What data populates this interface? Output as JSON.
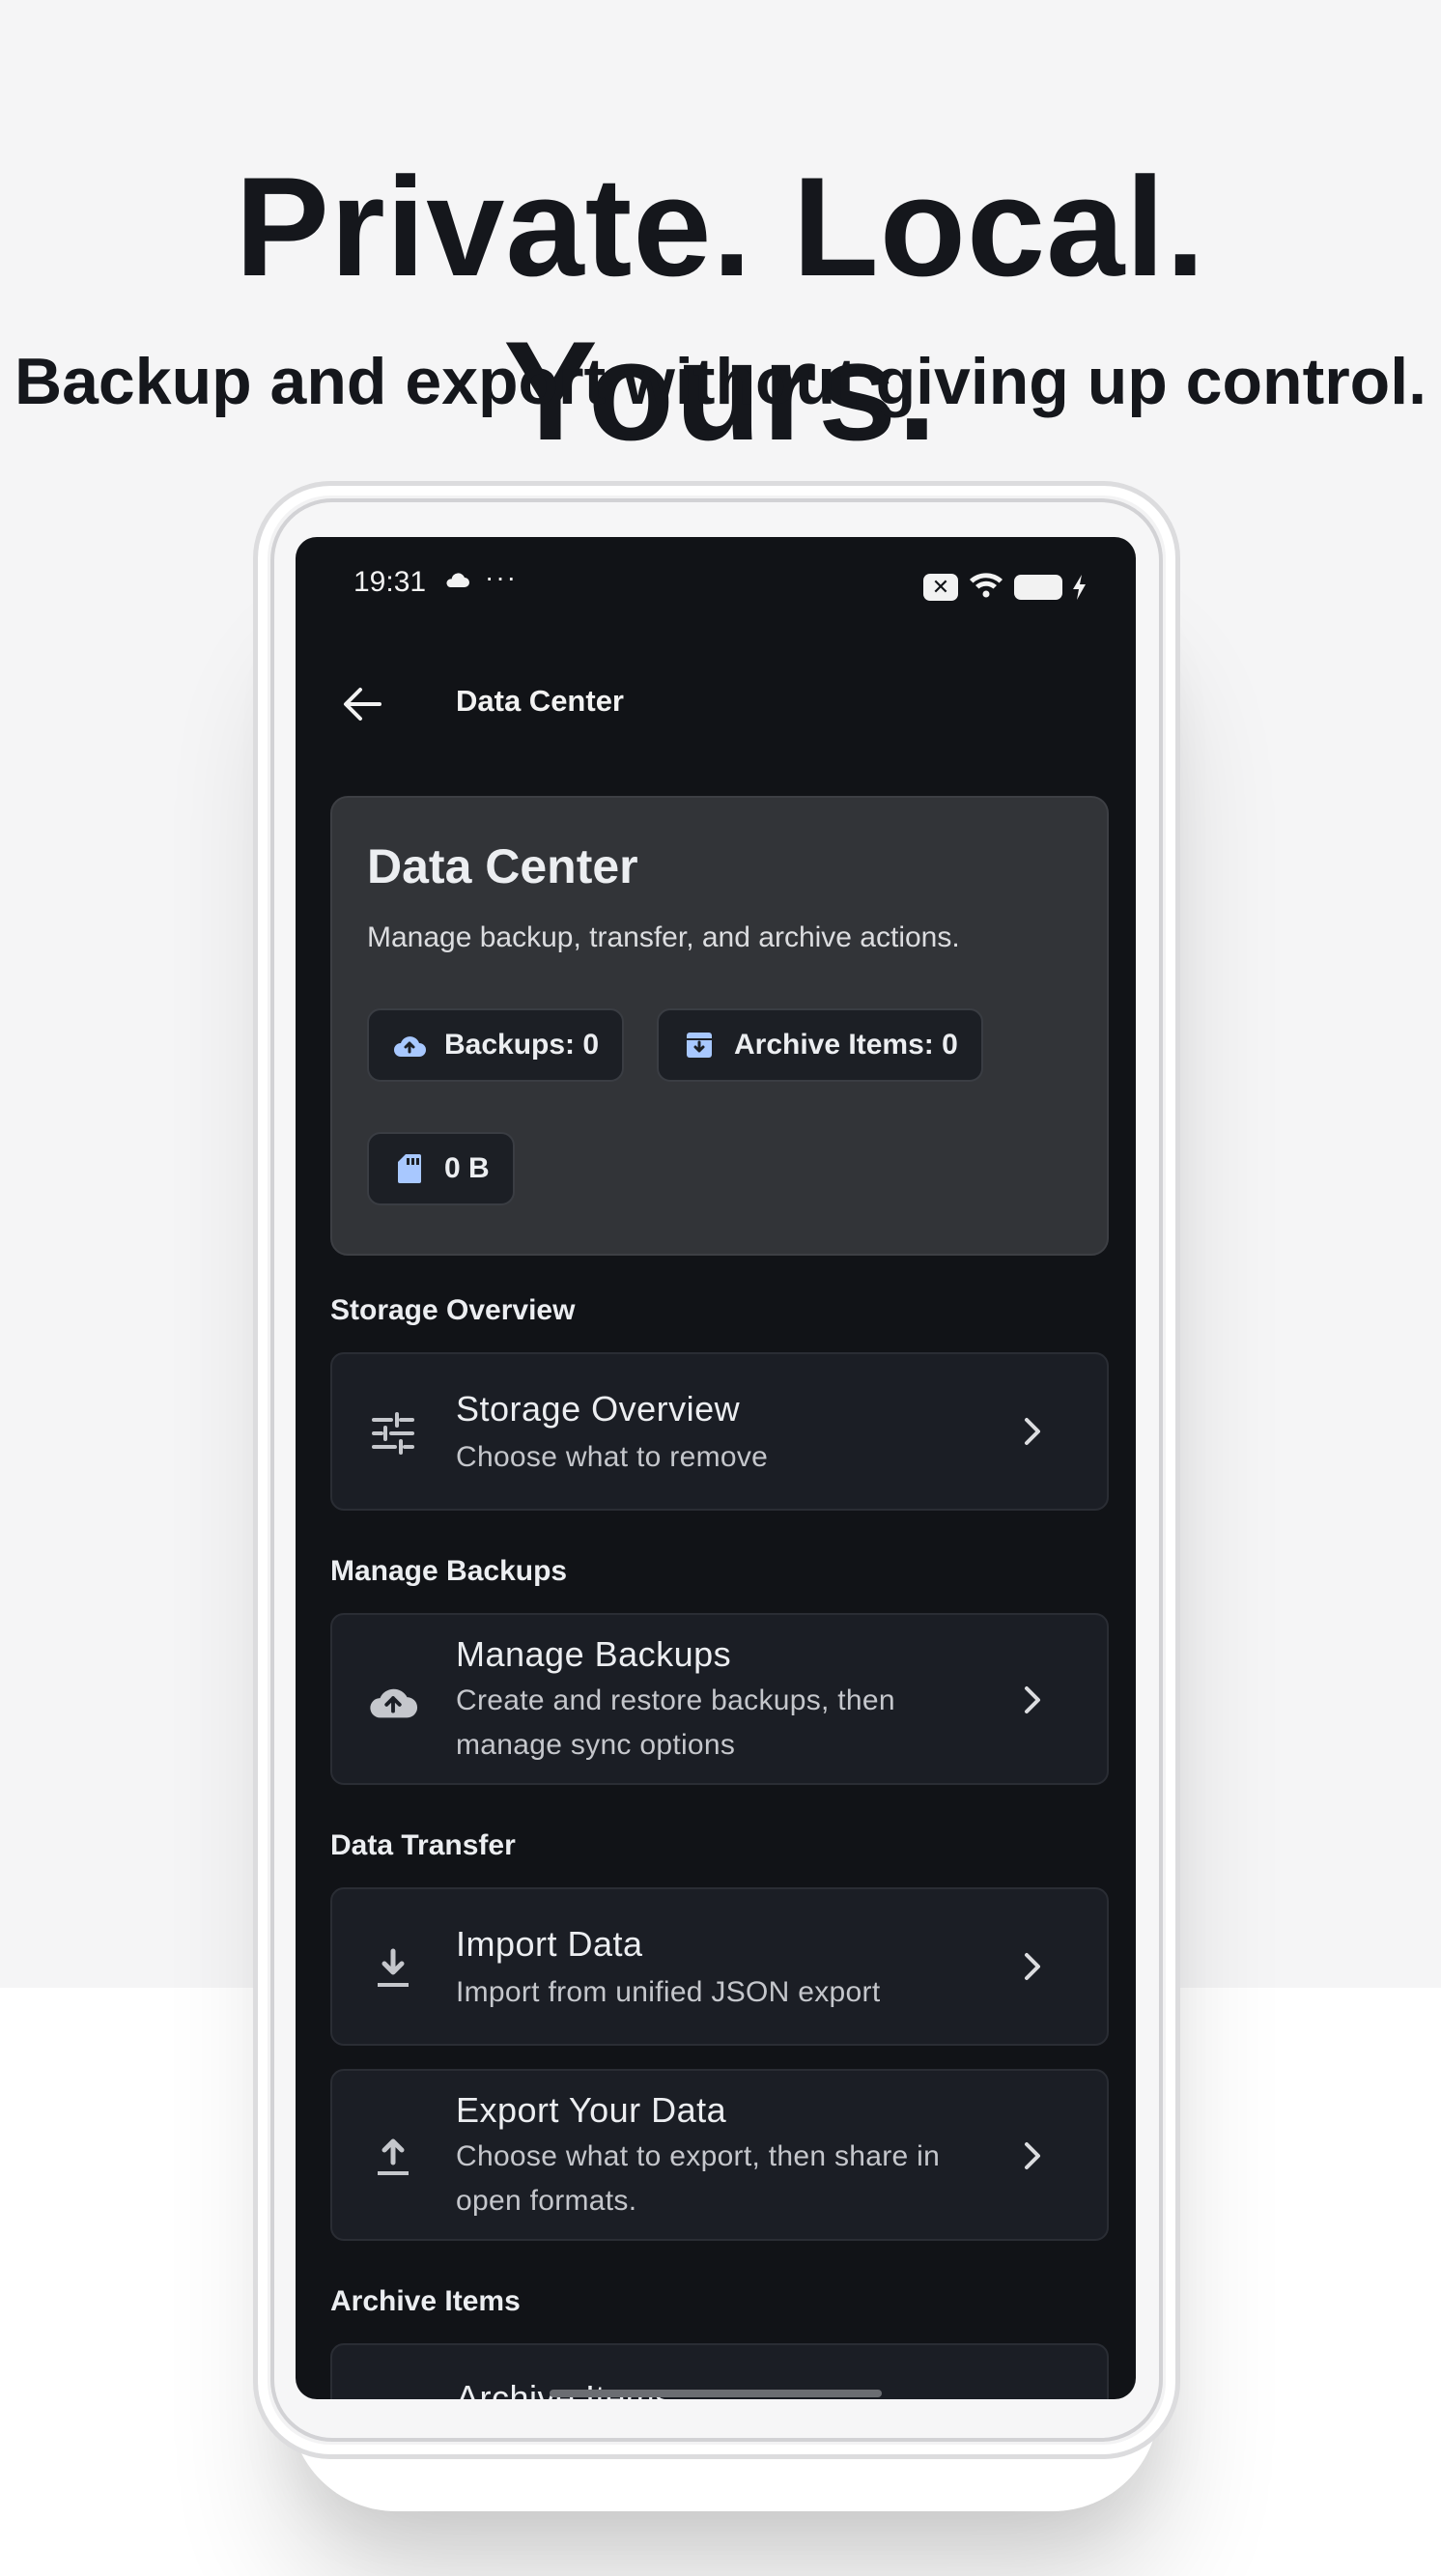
{
  "promo": {
    "headline": "Private. Local. Yours.",
    "subline": "Backup and export without giving up control."
  },
  "status_bar": {
    "time": "19:31",
    "overflow": "···",
    "icons": [
      "cloud-icon",
      "notification-x-icon",
      "wifi-icon",
      "battery-icon",
      "charging-bolt-icon"
    ]
  },
  "topbar": {
    "title": "Data Center",
    "back_icon": "arrow-left-icon"
  },
  "hero": {
    "title": "Data Center",
    "description": "Manage backup, transfer, and archive actions.",
    "chips": [
      {
        "icon": "cloud-upload-icon",
        "label": "Backups: 0"
      },
      {
        "icon": "archive-box-icon",
        "label": "Archive Items: 0"
      },
      {
        "icon": "sd-card-icon",
        "label": "0 B"
      }
    ]
  },
  "sections": {
    "storage": {
      "heading": "Storage Overview",
      "item": {
        "icon": "sliders-icon",
        "title": "Storage Overview",
        "subtitle": "Choose what to remove"
      }
    },
    "backups": {
      "heading": "Manage Backups",
      "item": {
        "icon": "cloud-upload-icon",
        "title": "Manage Backups",
        "subtitle": "Create and restore backups, then manage sync options"
      }
    },
    "transfer": {
      "heading": "Data Transfer",
      "import": {
        "icon": "download-icon",
        "title": "Import Data",
        "subtitle": "Import from unified JSON export"
      },
      "export": {
        "icon": "upload-icon",
        "title": "Export Your Data",
        "subtitle": "Choose what to export, then share in open formats."
      }
    },
    "archive": {
      "heading": "Archive Items",
      "item": {
        "title": "Archive Items"
      }
    }
  },
  "colors": {
    "screen_bg": "#111317",
    "card_bg": "#1b1e25",
    "hero_bg": "#323438",
    "accent_icon": "#a8c8ff"
  }
}
